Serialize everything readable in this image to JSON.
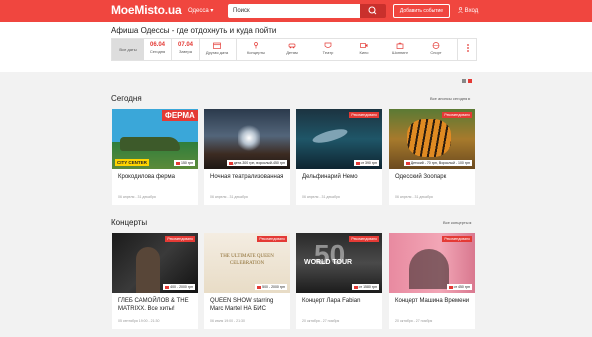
{
  "topbar": {
    "logo": "MoeMisto.ua",
    "city": "Одесса ▾",
    "search_placeholder": "Поиск",
    "add_event": "Добавить событие",
    "login": "Вход"
  },
  "page_title": "Афиша Одессы - где отдохнуть и куда пойти",
  "filters": {
    "all_dates": "Все даты",
    "today": {
      "num": "06.04",
      "label": "Сегодня"
    },
    "tomorrow": {
      "num": "07.04",
      "label": "Завтра"
    },
    "other_date": "Другая дата",
    "categories": [
      "Концерты",
      "Детям",
      "Театр",
      "Кино",
      "Шоппинг",
      "Спорт"
    ]
  },
  "sections": [
    {
      "title": "Сегодня",
      "all_link": "Все анонсы сегодня ▸",
      "cards": [
        {
          "title": "Крокодилова ферма",
          "date": "06 апреля - 31 декабря",
          "price": "150 грн",
          "badge": "",
          "overlay": "ФЕРМА",
          "sign": "CITY CENTER"
        },
        {
          "title": "Ночная театрализованная",
          "date": "06 апреля - 31 декабря",
          "price": "дети-300 грн, взрослый-450 грн",
          "badge": "",
          "overlay": "",
          "sign": ""
        },
        {
          "title": "Дельфинарий Немо",
          "date": "06 апреля - 31 декабря",
          "price": "от 390 грн",
          "badge": "Рекомендовано",
          "overlay": "",
          "sign": ""
        },
        {
          "title": "Одесский Зоопарк",
          "date": "06 апреля - 31 декабря",
          "price": "Детский - 70 грн, Взрослый - 100 грн",
          "badge": "Рекомендовано",
          "overlay": "",
          "sign": ""
        }
      ]
    },
    {
      "title": "Концерты",
      "all_link": "Все концерты ▸",
      "cards": [
        {
          "title": "ГЛЕБ САМОЙЛОВ & THE MATRIXX. Все хиты!",
          "date": "05 сентября 19:00 - 21:30",
          "price": "400 - 2000 грн",
          "badge": "Рекомендовано",
          "overlay": "",
          "sign": ""
        },
        {
          "title": "QUEEN SHOW starring Marc Martel НА БИС",
          "date": "06 июля 19:00 - 21:30",
          "price": "500 - 2000 грн",
          "badge": "Рекомендовано",
          "overlay": "THE ULTIMATE QUEEN CELEBRATION",
          "sign": ""
        },
        {
          "title": "Концерт Лара Fabian",
          "date": "20 октября - 27 ноября",
          "price": "от 1580 грн",
          "badge": "Рекомендовано",
          "overlay": "WORLD TOUR",
          "sign": "50"
        },
        {
          "title": "Концерт Машина Времени",
          "date": "20 октября - 27 ноября",
          "price": "от 450 грн",
          "badge": "Рекомендовано",
          "overlay": "",
          "sign": ""
        }
      ]
    }
  ],
  "colors": {
    "brand": "#f0463f",
    "accent": "#e43a35"
  }
}
